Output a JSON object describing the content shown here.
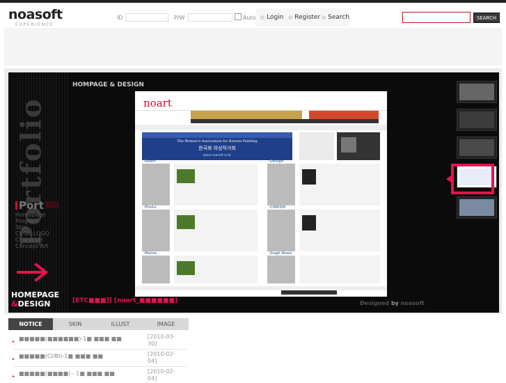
{
  "header": {
    "logo_main": "noasoft",
    "logo_sub": "EXPERIENCE",
    "id_label": "ID",
    "pw_label": "P/W",
    "auto_label": "Auto",
    "links": [
      "Login",
      "Register",
      "Search"
    ],
    "search_button": "SEARCH"
  },
  "portfolio": {
    "vertical_label": "Portfolio",
    "heading": "HOMPAGE & DESIGN",
    "menu_title": "Port",
    "menu_items": [
      "Homepage",
      "Program",
      "Skin",
      "CI, BI, LOGO",
      "Character",
      "Concept Art"
    ],
    "section_title_line1": "HOMEPAGE",
    "section_title_amp": "&",
    "section_title_line2": "DESIGN",
    "etc_label": "[ETC■■■]] [noart_■■■■■■]",
    "designed_prefix": "Designed",
    "designed_by": "by",
    "designed_name": "noasoft"
  },
  "site_preview": {
    "logo": "noart",
    "banner_line1": "The Women's Association for Korean Painting",
    "banner_line2": "한국화 여성작가회",
    "banner_line3": "www.noasoft.or.kr",
    "sections": [
      "Noart",
      "Design",
      "Photo",
      "CHRISM",
      "Maina",
      "Gogh News"
    ]
  },
  "tabs": [
    {
      "label": "NOTICE",
      "active": true
    },
    {
      "label": "SKIN",
      "active": false
    },
    {
      "label": "ILLUST",
      "active": false
    },
    {
      "label": "IMAGE",
      "active": false
    }
  ],
  "notices": [
    {
      "title": "■■■■■(■■■■■■)-1■ ■■■ ■■",
      "date_line1": "[2010-03-",
      "date_line2": "30]"
    },
    {
      "title": "■■■■■(CI/BI)-1■ ■■■ ■■",
      "date_line1": "[2010-02-",
      "date_line2": "04]"
    },
    {
      "title": "■■■■■(■■■■) - 1■ ■■■ ■■",
      "date_line1": "[2010-02-",
      "date_line2": "04]"
    }
  ]
}
